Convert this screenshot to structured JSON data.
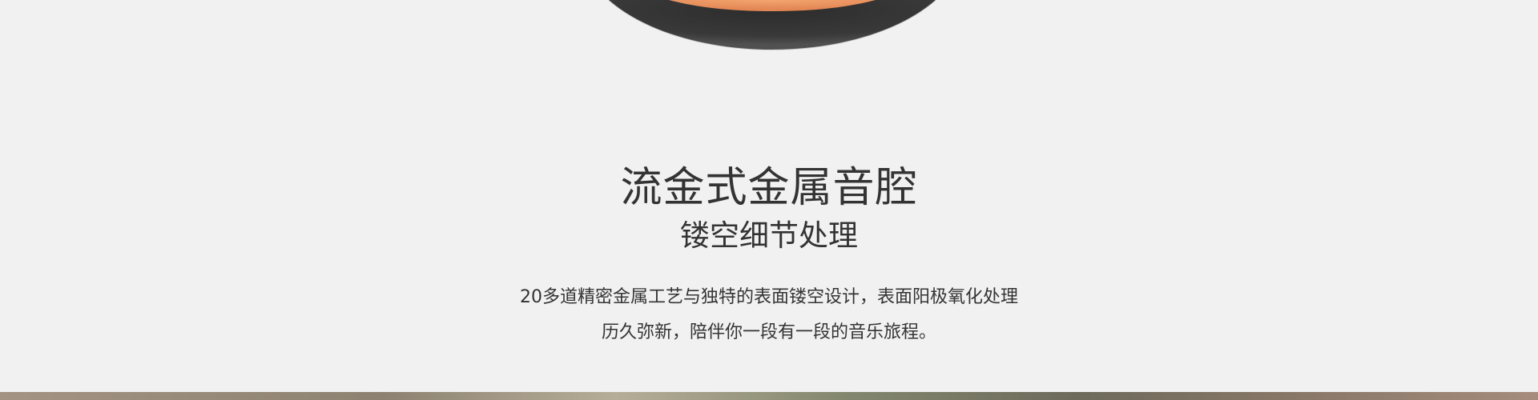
{
  "feature": {
    "headline": "流金式金属音腔",
    "subheadline": "镂空细节处理",
    "description_lines": [
      "20多道精密金属工艺与独特的表面镂空设计，表面阳极氧化处理",
      "历久弥新，陪伴你一段有一段的音乐旅程。"
    ]
  },
  "colors": {
    "background": "#f1f1f1",
    "text": "#333333",
    "speaker_body": "#3a3a3a",
    "speaker_accent": "#e8965f"
  },
  "icons": {
    "product_image": "speaker-cavity-image",
    "lifestyle_photo": "lifestyle-photo-strip"
  }
}
